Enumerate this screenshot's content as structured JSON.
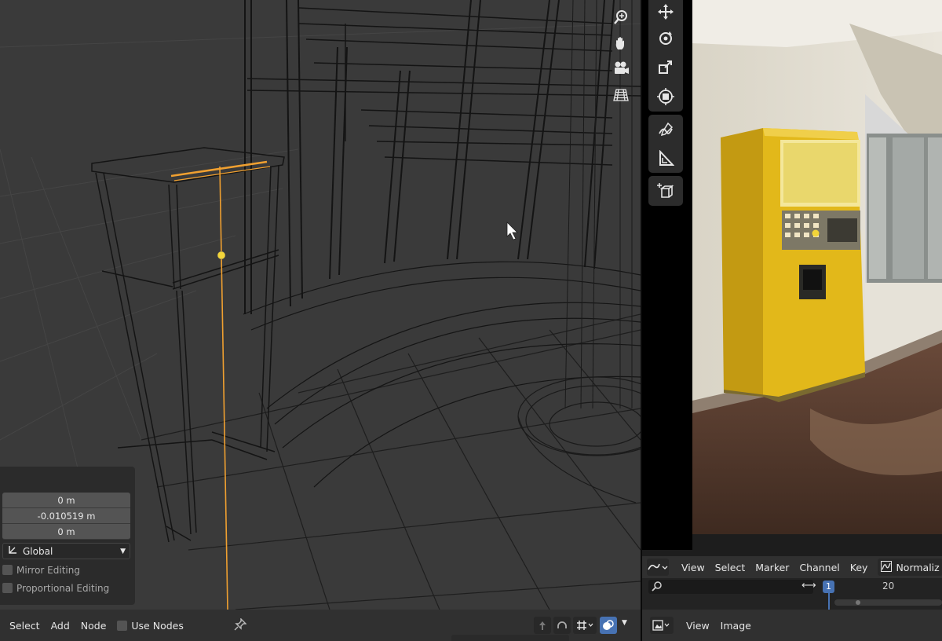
{
  "redo_panel": {
    "location_x": "0 m",
    "location_y": "-0.010519 m",
    "location_z": "0 m",
    "orientation": "Global",
    "mirror_editing": "Mirror Editing",
    "proportional_editing": "Proportional Editing"
  },
  "graph_editor": {
    "menu": [
      "View",
      "Select",
      "Marker",
      "Channel",
      "Key"
    ],
    "normalize": "Normaliz",
    "current_frame": "1",
    "frame_tick": "20"
  },
  "node_editor_header": {
    "select": "Select",
    "add": "Add",
    "node": "Node",
    "use_nodes": "Use Nodes"
  },
  "image_editor_header": {
    "view": "View",
    "image": "Image"
  },
  "icons": {
    "viewport_nav": [
      "zoom-icon",
      "hand-pan-icon",
      "camera-icon",
      "grid-icon"
    ],
    "tools": [
      "move-icon",
      "rotate-icon",
      "scale-icon",
      "transform-icon",
      "annotate-icon",
      "measure-icon",
      "add-cube-icon"
    ]
  },
  "colors": {
    "viewport_bg": "#3a3a3a",
    "selection_orange": "#f0a030",
    "active_frame_blue": "#4772b3",
    "machine_yellow": "#e2b81a"
  }
}
